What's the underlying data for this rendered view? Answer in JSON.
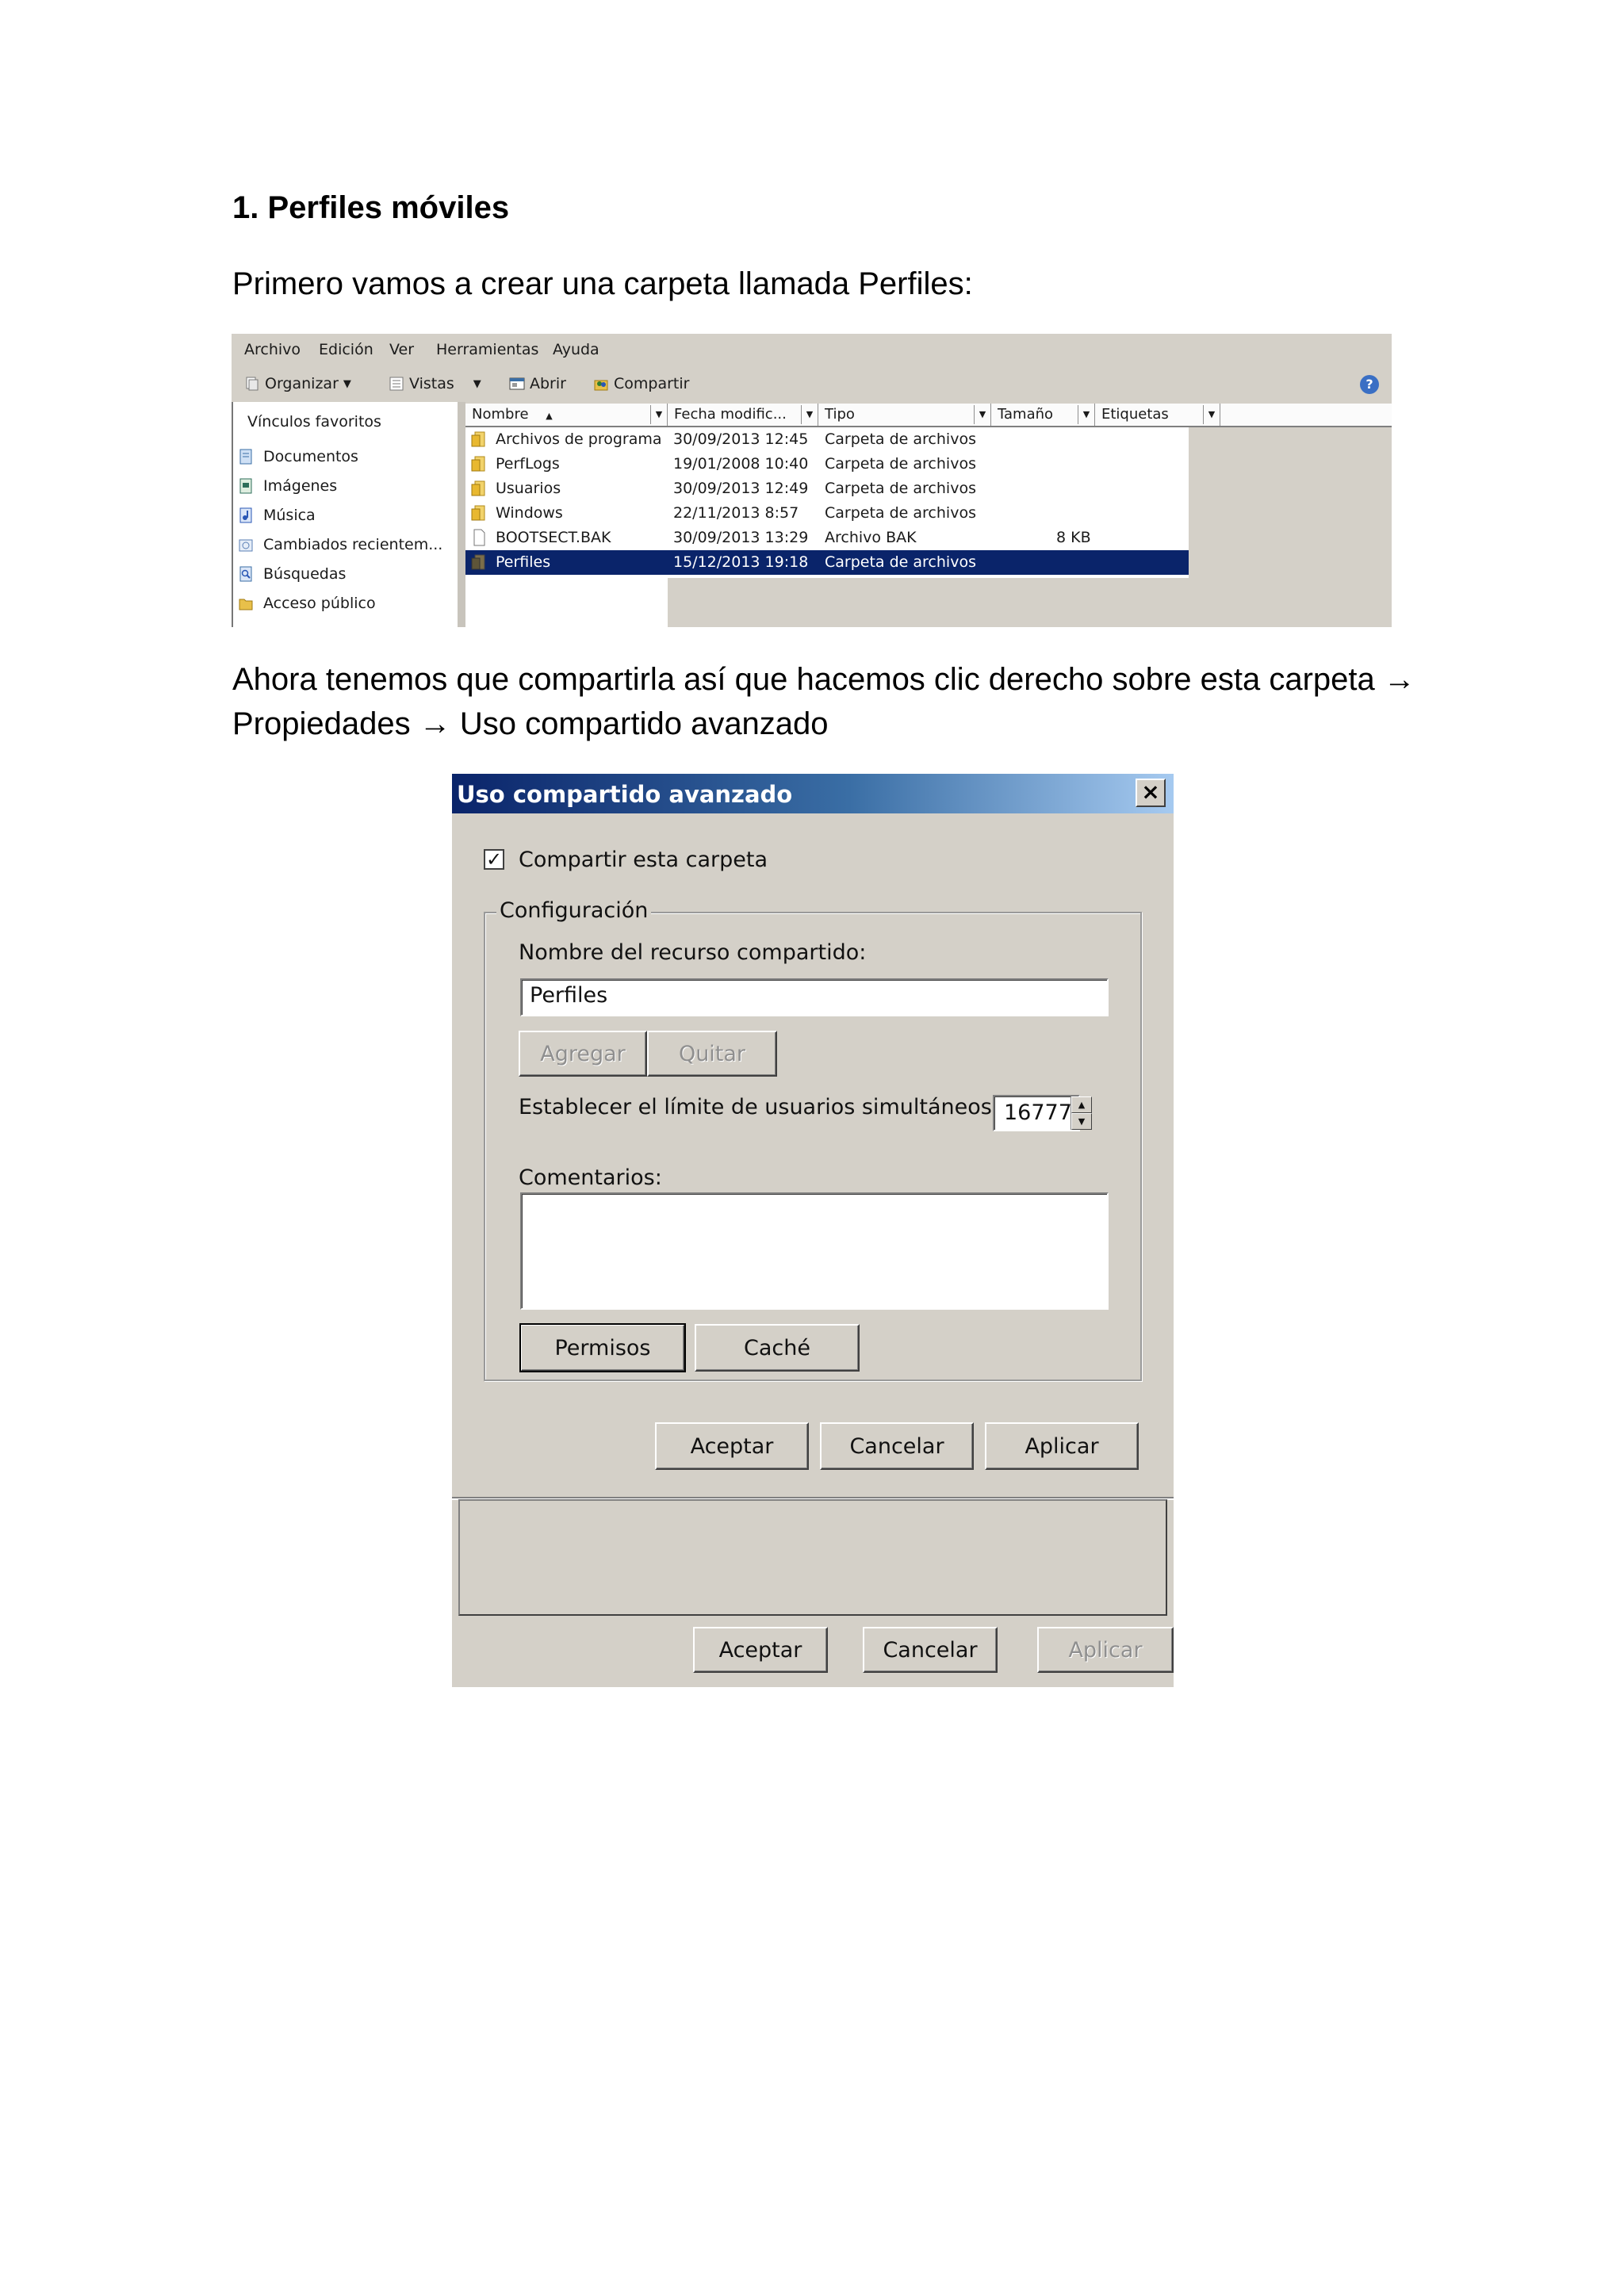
{
  "document": {
    "heading": "1. Perfiles móviles",
    "paragraph1": "Primero vamos a crear una carpeta llamada Perfiles:",
    "paragraph2": "Ahora tenemos que  compartirla así que hacemos clic derecho sobre esta carpeta → Propiedades → Uso compartido avanzado"
  },
  "explorer": {
    "menu": [
      "Archivo",
      "Edición",
      "Ver",
      "Herramientas",
      "Ayuda"
    ],
    "toolbar": {
      "organize": "Organizar",
      "views": "Vistas",
      "open": "Abrir",
      "share": "Compartir"
    },
    "nav": {
      "title": "Vínculos favoritos",
      "items": [
        "Documentos",
        "Imágenes",
        "Música",
        "Cambiados recientem...",
        "Búsquedas",
        "Acceso público"
      ]
    },
    "columns": [
      "Nombre",
      "Fecha modific...",
      "Tipo",
      "Tamaño",
      "Etiquetas"
    ],
    "rows": [
      {
        "name": "Archivos de programa",
        "date": "30/09/2013 12:45",
        "type": "Carpeta de archivos",
        "size": ""
      },
      {
        "name": "PerfLogs",
        "date": "19/01/2008 10:40",
        "type": "Carpeta de archivos",
        "size": ""
      },
      {
        "name": "Usuarios",
        "date": "30/09/2013 12:49",
        "type": "Carpeta de archivos",
        "size": ""
      },
      {
        "name": "Windows",
        "date": "22/11/2013 8:57",
        "type": "Carpeta de archivos",
        "size": ""
      },
      {
        "name": "BOOTSECT.BAK",
        "date": "30/09/2013 13:29",
        "type": "Archivo BAK",
        "size": "8 KB"
      },
      {
        "name": "Perfiles",
        "date": "15/12/2013 19:18",
        "type": "Carpeta de archivos",
        "size": ""
      }
    ],
    "selected_row": "Perfiles",
    "colors": {
      "selection": "#0a246a",
      "window": "#d4d0c8"
    }
  },
  "dialog": {
    "title": "Uso compartido avanzado",
    "share_checkbox": {
      "label": "Compartir esta carpeta",
      "checked": true
    },
    "group_label": "Configuración",
    "share_name_label": "Nombre del recurso compartido:",
    "share_name_value": "Perfiles",
    "add_button": "Agregar",
    "remove_button": "Quitar",
    "user_limit_label": "Establecer el límite de usuarios simultáneos en:",
    "user_limit_value": "16777",
    "comments_label": "Comentarios:",
    "comments_value": "",
    "permissions_button": "Permisos",
    "cache_button": "Caché",
    "ok_button": "Aceptar",
    "cancel_button": "Cancelar",
    "apply_button": "Aplicar",
    "parent_ok_button": "Aceptar",
    "parent_cancel_button": "Cancelar",
    "parent_apply_button": "Aplicar"
  }
}
